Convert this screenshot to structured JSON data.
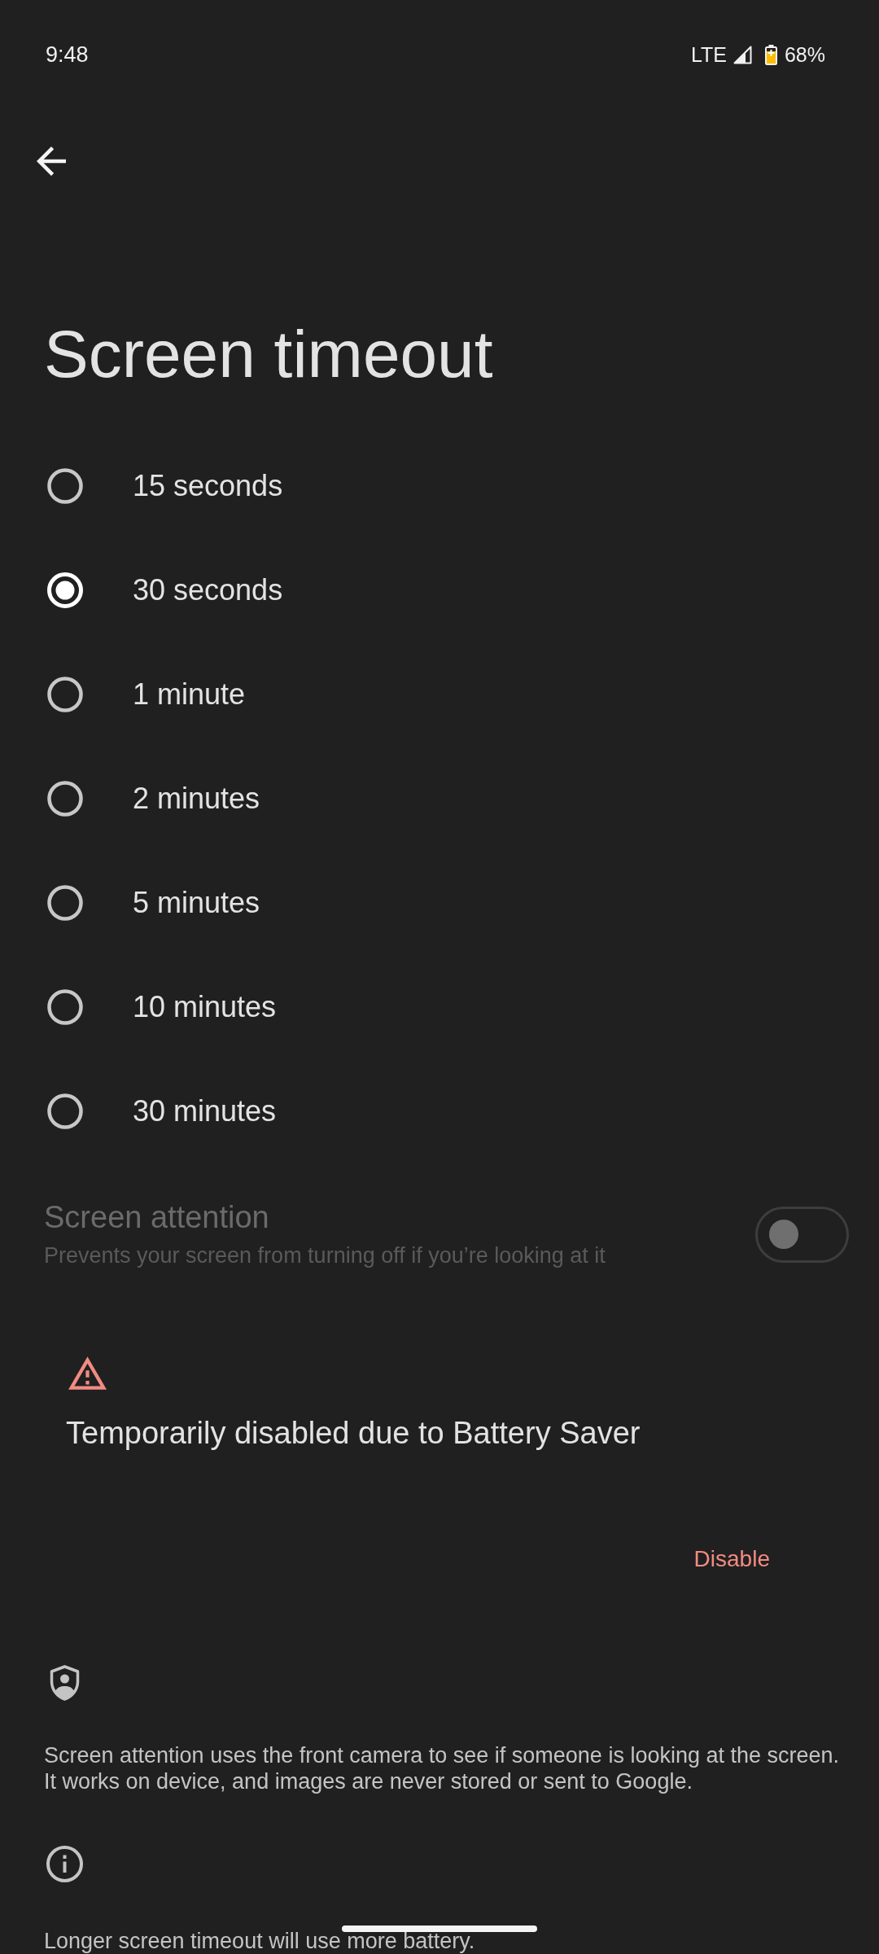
{
  "status_bar": {
    "time": "9:48",
    "network": "LTE",
    "battery_saver": true,
    "battery_percent": "68%"
  },
  "title": "Screen timeout",
  "options": [
    {
      "label": "15 seconds",
      "selected": false
    },
    {
      "label": "30 seconds",
      "selected": true
    },
    {
      "label": "1 minute",
      "selected": false
    },
    {
      "label": "2 minutes",
      "selected": false
    },
    {
      "label": "5 minutes",
      "selected": false
    },
    {
      "label": "10 minutes",
      "selected": false
    },
    {
      "label": "30 minutes",
      "selected": false
    }
  ],
  "screen_attention": {
    "title": "Screen attention",
    "summary": "Prevents your screen from turning off if you’re looking at it",
    "disabled": true,
    "on": false
  },
  "warning": {
    "message": "Temporarily disabled due to Battery Saver",
    "action": "Disable"
  },
  "footers": [
    {
      "kind": "privacy",
      "text": "Screen attention uses the front camera to see if someone is looking at the screen. It works on device, and images are never stored or sent to Google."
    },
    {
      "kind": "info",
      "text": "Longer screen timeout will use more battery."
    }
  ]
}
